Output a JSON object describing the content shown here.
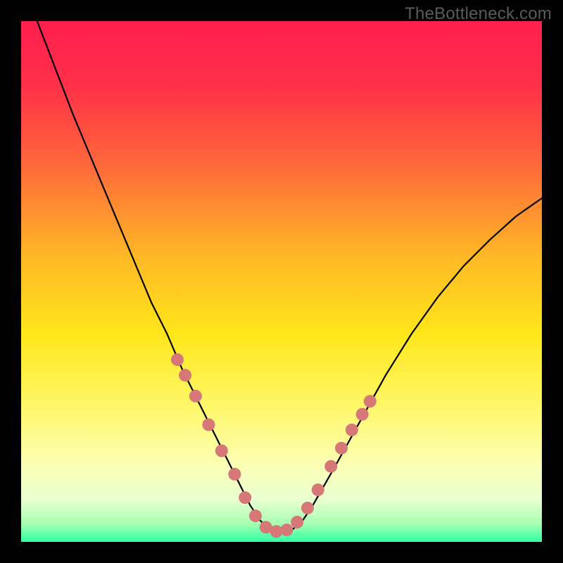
{
  "watermark": "TheBottleneck.com",
  "colors": {
    "frame": "#000000",
    "gradient_stops": [
      {
        "offset": 0.0,
        "color": "#ff1f4d"
      },
      {
        "offset": 0.12,
        "color": "#ff2f49"
      },
      {
        "offset": 0.28,
        "color": "#ff6a3a"
      },
      {
        "offset": 0.45,
        "color": "#ffb726"
      },
      {
        "offset": 0.6,
        "color": "#ffe61a"
      },
      {
        "offset": 0.74,
        "color": "#fff76a"
      },
      {
        "offset": 0.85,
        "color": "#fcffb3"
      },
      {
        "offset": 0.92,
        "color": "#e8ffcf"
      },
      {
        "offset": 0.965,
        "color": "#a7ffb3"
      },
      {
        "offset": 1.0,
        "color": "#2fffa3"
      }
    ],
    "curve": "#000000",
    "marker_fill": "#d77878",
    "marker_stroke": "#cf6d6d"
  },
  "chart_data": {
    "type": "line",
    "title": "",
    "xlabel": "",
    "ylabel": "",
    "xlim": [
      0,
      100
    ],
    "ylim": [
      0,
      100
    ],
    "series": [
      {
        "name": "bottleneck-curve",
        "x": [
          0,
          5,
          10,
          15,
          20,
          25,
          28,
          31,
          34,
          37,
          40,
          42,
          44,
          46,
          48,
          50,
          52,
          54,
          56,
          60,
          65,
          70,
          75,
          80,
          85,
          90,
          95,
          100
        ],
        "y": [
          108,
          95,
          82,
          70,
          58,
          46,
          40,
          33,
          27,
          21,
          15,
          11,
          7,
          4,
          2.3,
          2,
          2.3,
          4,
          7,
          14,
          23,
          32,
          40,
          47,
          53,
          58,
          62.5,
          66
        ]
      }
    ],
    "markers": {
      "name": "highlight-dots",
      "x": [
        30,
        31.5,
        33.5,
        36.0,
        38.5,
        41.0,
        43.0,
        45.0,
        47.0,
        49.0,
        51.0,
        53.0,
        55.0,
        57.0,
        59.5,
        61.5,
        63.5,
        65.5,
        67.0
      ],
      "y": [
        35,
        32,
        28,
        22.5,
        17.5,
        13,
        8.5,
        5,
        2.8,
        2,
        2.3,
        3.8,
        6.5,
        10,
        14.5,
        18,
        21.5,
        24.5,
        27
      ]
    }
  }
}
